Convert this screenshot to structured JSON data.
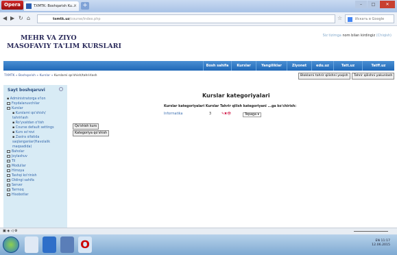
{
  "browser": {
    "opera_label": "Opera",
    "tab_title": "TXMTK: Boshqarish Ku...",
    "tab_close": "×",
    "new_tab": "+",
    "url_host": "tsmtk.uz",
    "url_path": "/course/index.php",
    "search_placeholder": "Искать в Google"
  },
  "site": {
    "logo_line1": "MEHR VA ZIYO",
    "logo_line2": "MASOFAVIY TA'LIM KURSLARI",
    "login_pre": "Siz tizimga",
    "login_name": "nom bilan kirdingiz",
    "login_exit": "(Chiqish)"
  },
  "menu": [
    "Bosh sahifa",
    "Kurslar",
    "Yangiliklar",
    "Ziyonet",
    "edu.uz",
    "Tatt.uz",
    "Tatff.uz"
  ],
  "breadcrumb": {
    "items": [
      "TXMTK",
      "Boshqarish",
      "Kurslar"
    ],
    "current": "Kurslarni qo'shish/tahrirlash",
    "sep": " » "
  },
  "top_buttons": {
    "blocks": "Bloklarni tahrir qilishni yoqish",
    "edit_off": "Tahrir qilishni yakunlash"
  },
  "sidebar": {
    "title": "Sayt boshqaruvi",
    "items": [
      {
        "text": "Administratorga e'lon",
        "type": "bul"
      },
      {
        "text": "Foydalanuvchilar",
        "type": "fold"
      },
      {
        "text": "Kurslar",
        "type": "foldopen"
      },
      {
        "text": "Kurslarni qo'shish/",
        "type": "sub"
      },
      {
        "text": "tahrirlash",
        "type": "cont"
      },
      {
        "text": "Ro'yxatdan o'tish",
        "type": "sub"
      },
      {
        "text": "Course default settings",
        "type": "sub"
      },
      {
        "text": "Kurs so'rovi",
        "type": "sub"
      },
      {
        "text": "Zaxira sifatida",
        "type": "sub"
      },
      {
        "text": "saqlanganlar(Havolalik",
        "type": "cont"
      },
      {
        "text": "maqsadida)",
        "type": "cont"
      },
      {
        "text": "Baholar",
        "type": "fold"
      },
      {
        "text": "Joylashuv",
        "type": "fold"
      },
      {
        "text": "Til",
        "type": "fold"
      },
      {
        "text": "Modullar",
        "type": "fold"
      },
      {
        "text": "Himoya",
        "type": "fold"
      },
      {
        "text": "Tashqi ko'rinish",
        "type": "fold"
      },
      {
        "text": "Oldingi sahifa",
        "type": "fold"
      },
      {
        "text": "Server",
        "type": "fold"
      },
      {
        "text": "Tarmoq",
        "type": "fold"
      },
      {
        "text": "Hisobotlar",
        "type": "fold"
      }
    ]
  },
  "left_buttons": {
    "add_course": "Qo'shish kurs",
    "add_category": "Kategoriya qo'shish"
  },
  "main": {
    "heading": "Kurslar kategoriyalari",
    "table_header": "Kurslar kategoriyalari Kurslar Tahrir qilish kategoriyani ...ga ko'chirish:",
    "rows": [
      {
        "name": "Informatika",
        "count": "3",
        "icons": "✎✖👁",
        "move_to": "Tepaga ▾"
      }
    ]
  },
  "taskbar": {
    "lang": "EN",
    "time": "11:17",
    "date": "12.06.2015"
  }
}
